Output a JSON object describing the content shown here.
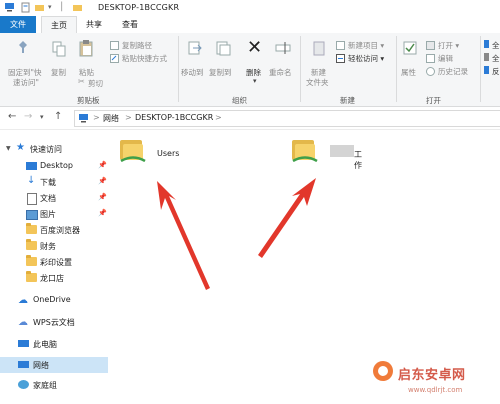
{
  "window": {
    "title": "DESKTOP-1BCCGKR"
  },
  "ribbon_tabs": {
    "file": "文件",
    "home": "主页",
    "share": "共享",
    "view": "查看"
  },
  "ribbon": {
    "pin_quick_access": [
      "固定到\"快",
      "速访问\""
    ],
    "copy": "复制",
    "paste": "粘贴",
    "cut": "剪切",
    "copy_path": "复制路径",
    "paste_shortcut": "粘贴快捷方式",
    "clipboard_group": "剪贴板",
    "move_to": "移动到",
    "copy_to": "复制到",
    "delete": "删除",
    "rename": "重命名",
    "organize_group": "组织",
    "new_folder": [
      "新建",
      "文件夹"
    ],
    "new_item": "新建项目 ▾",
    "easy_access": "轻松访问 ▾",
    "new_group": "新建",
    "properties": "属性",
    "open": "打开 ▾",
    "edit": "编辑",
    "history": "历史记录",
    "open_group": "打开",
    "all": "全",
    "none": "全",
    "invert": "反"
  },
  "address": {
    "network": "网络",
    "computer": "DESKTOP-1BCCGKR",
    "sep": ">"
  },
  "nav_pane": {
    "quick_access": "快速访问",
    "items": [
      "Desktop",
      "下载",
      "文档",
      "图片",
      "百度浏览器",
      "财务",
      "彩印设置",
      "龙口店"
    ],
    "onedrive": "OneDrive",
    "wps": "WPS云文档",
    "this_pc": "此电脑",
    "network": "网络",
    "homegroup": "家庭组"
  },
  "content": {
    "items": [
      "Users",
      "工作"
    ]
  },
  "watermark": {
    "text": "启东安卓网",
    "url": "www.qdlrjt.com"
  }
}
